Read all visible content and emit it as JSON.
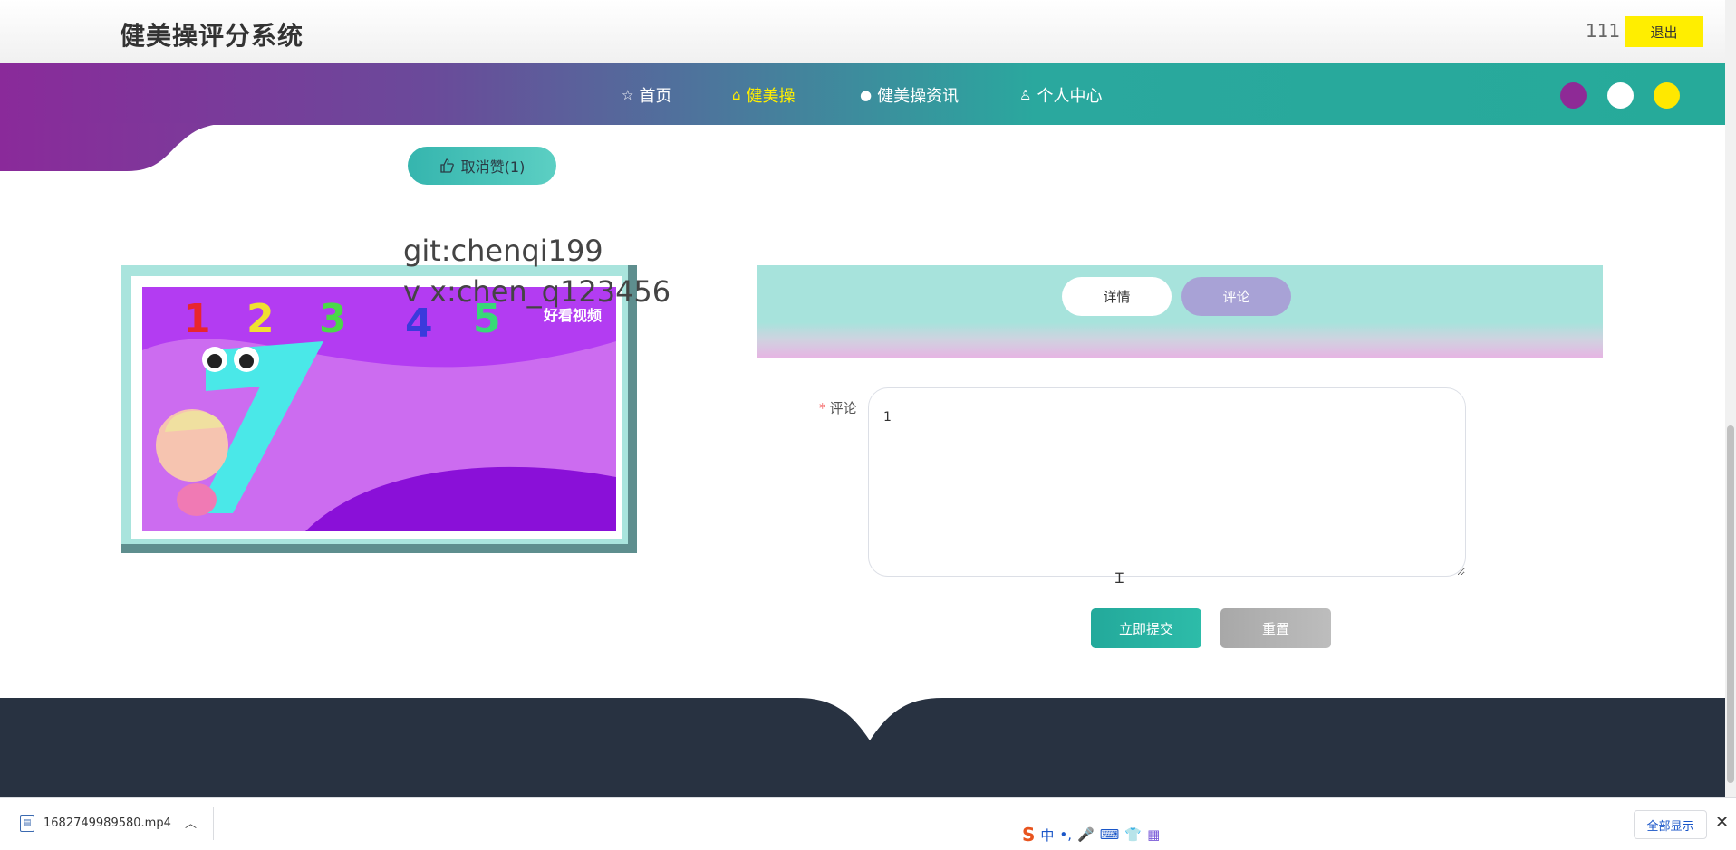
{
  "header": {
    "title": "健美操评分系统",
    "username": "111",
    "logout_label": "退出"
  },
  "nav": {
    "items": [
      {
        "label": "首页",
        "icon": "star-icon"
      },
      {
        "label": "健美操",
        "icon": "bag-icon",
        "active": true
      },
      {
        "label": "健美操资讯",
        "icon": "info-icon"
      },
      {
        "label": "个人中心",
        "icon": "user-icon"
      }
    ],
    "theme_colors": [
      "#8e2a96",
      "#ffffff",
      "#ffe800"
    ]
  },
  "content": {
    "unlike_label": "取消赞(1)",
    "watermark_line1": "git:chenqi199",
    "watermark_line2": "v x:chen_q123456",
    "video_overlay_label": "好看视频"
  },
  "tabs": {
    "detail_label": "详情",
    "comment_label": "评论",
    "active": "comment"
  },
  "form": {
    "required_mark": "*",
    "comment_label": "评论",
    "comment_value": "1",
    "submit_label": "立即提交",
    "reset_label": "重置"
  },
  "download_bar": {
    "file_name": "1682749989580.mp4",
    "ime_label": "中",
    "show_all_label": "全部显示"
  },
  "colors": {
    "nav_active": "#ffee00",
    "logout_bg": "#ffee00",
    "primary": "#23a99b"
  }
}
